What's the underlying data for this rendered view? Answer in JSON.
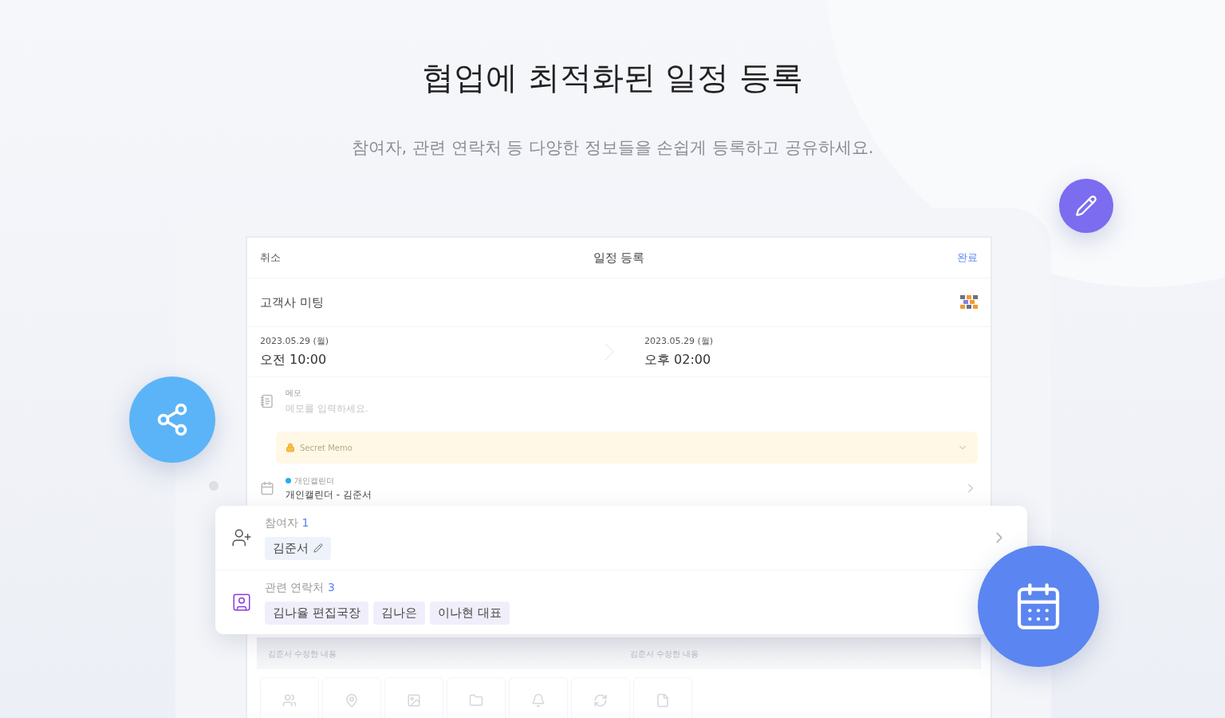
{
  "headline": {
    "title": "협업에 최적화된 일정 등록",
    "subtitle": "참여자, 관련 연락처 등 다양한 정보들을 손쉽게 등록하고 공유하세요."
  },
  "screen": {
    "cancel": "취소",
    "title": "일정 등록",
    "done": "완료",
    "event_name": "고객사 미팅",
    "start": {
      "date": "2023.05.29 (월)",
      "period": "오전",
      "time": "10:00"
    },
    "end": {
      "date": "2023.05.29 (월)",
      "period": "오후",
      "time": "02:00"
    },
    "memo": {
      "label": "메모",
      "placeholder": "메모를 입력하세요."
    },
    "secret_memo": {
      "label": "Secret Memo"
    },
    "calendar": {
      "name": "개인캘린더",
      "color": "#27aaf0",
      "value": "개인캘린더 - 김준서"
    },
    "history": [
      "김준서 수정한 내용",
      "김준서 수정한 내용"
    ]
  },
  "details": {
    "participants": {
      "label": "참여자",
      "count": "1",
      "chips": [
        "김준서"
      ]
    },
    "contacts": {
      "label": "관련 연락처",
      "count": "3",
      "chips": [
        "김나율 편집국장",
        "김나은",
        "이나현 대표"
      ]
    }
  }
}
